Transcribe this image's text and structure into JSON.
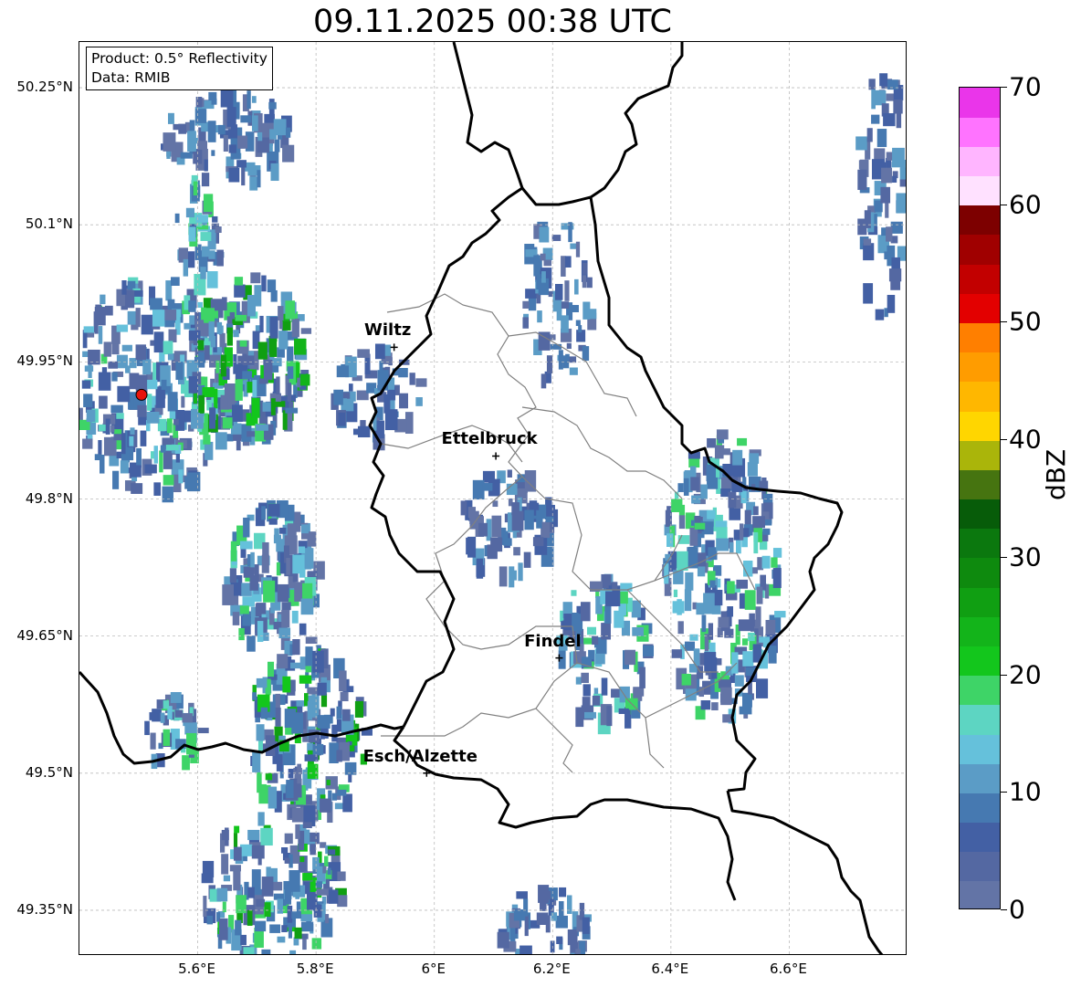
{
  "title": "09.11.2025 00:38 UTC",
  "info": {
    "product": "Product: 0.5° Reflectivity",
    "data": "Data: RMIB"
  },
  "map": {
    "extent_lon": [
      5.4,
      6.8
    ],
    "extent_lat": [
      49.3,
      50.3
    ],
    "lat_ticks": [
      {
        "value": 50.25,
        "label": "50.25°N"
      },
      {
        "value": 50.1,
        "label": "50.1°N"
      },
      {
        "value": 49.95,
        "label": "49.95°N"
      },
      {
        "value": 49.8,
        "label": "49.8°N"
      },
      {
        "value": 49.65,
        "label": "49.65°N"
      },
      {
        "value": 49.5,
        "label": "49.5°N"
      },
      {
        "value": 49.35,
        "label": "49.35°N"
      }
    ],
    "lon_ticks": [
      {
        "value": 5.6,
        "label": "5.6°E"
      },
      {
        "value": 5.8,
        "label": "5.8°E"
      },
      {
        "value": 6.0,
        "label": "6°E"
      },
      {
        "value": 6.2,
        "label": "6.2°E"
      },
      {
        "value": 6.4,
        "label": "6.4°E"
      },
      {
        "value": 6.6,
        "label": "6.6°E"
      }
    ],
    "radar_site": {
      "lon": 5.505,
      "lat": 49.914,
      "color": "#e8140c"
    },
    "cities": [
      {
        "name": "Wiltz",
        "lon": 5.932,
        "lat": 49.966
      },
      {
        "name": "Ettelbruck",
        "lon": 6.104,
        "lat": 49.847
      },
      {
        "name": "Findel",
        "lon": 6.211,
        "lat": 49.626
      },
      {
        "name": "Esch/Alzette",
        "lon": 5.987,
        "lat": 49.5
      }
    ],
    "echo_regions": [
      {
        "lon": 5.52,
        "lat": 49.93,
        "rlon": 0.14,
        "rlat": 0.12,
        "n": 260,
        "level": 2
      },
      {
        "lon": 5.68,
        "lat": 49.96,
        "rlon": 0.1,
        "rlat": 0.09,
        "n": 200,
        "level": 3
      },
      {
        "lon": 5.72,
        "lat": 49.72,
        "rlon": 0.08,
        "rlat": 0.08,
        "n": 140,
        "level": 2
      },
      {
        "lon": 5.78,
        "lat": 49.55,
        "rlon": 0.1,
        "rlat": 0.1,
        "n": 190,
        "level": 3
      },
      {
        "lon": 5.72,
        "lat": 49.38,
        "rlon": 0.12,
        "rlat": 0.08,
        "n": 160,
        "level": 3
      },
      {
        "lon": 6.48,
        "lat": 49.72,
        "rlon": 0.1,
        "rlat": 0.16,
        "n": 260,
        "level": 2
      },
      {
        "lon": 6.28,
        "lat": 49.64,
        "rlon": 0.08,
        "rlat": 0.08,
        "n": 90,
        "level": 2
      },
      {
        "lon": 6.12,
        "lat": 49.78,
        "rlon": 0.08,
        "rlat": 0.06,
        "n": 70,
        "level": 1
      },
      {
        "lon": 6.2,
        "lat": 50.02,
        "rlon": 0.06,
        "rlat": 0.1,
        "n": 70,
        "level": 1
      },
      {
        "lon": 5.65,
        "lat": 50.2,
        "rlon": 0.12,
        "rlat": 0.05,
        "n": 90,
        "level": 1
      },
      {
        "lon": 6.75,
        "lat": 50.15,
        "rlon": 0.04,
        "rlat": 0.15,
        "n": 70,
        "level": 1
      },
      {
        "lon": 6.18,
        "lat": 49.33,
        "rlon": 0.08,
        "rlat": 0.05,
        "n": 60,
        "level": 1
      },
      {
        "lon": 5.9,
        "lat": 49.92,
        "rlon": 0.08,
        "rlat": 0.05,
        "n": 60,
        "level": 1
      },
      {
        "lon": 5.6,
        "lat": 50.1,
        "rlon": 0.04,
        "rlat": 0.06,
        "n": 40,
        "level": 2
      },
      {
        "lon": 5.55,
        "lat": 49.55,
        "rlon": 0.05,
        "rlat": 0.04,
        "n": 40,
        "level": 2
      }
    ],
    "border_color": "#000000",
    "admin_color": "#808080",
    "grid_color": "#bbbbbb"
  },
  "colorbar": {
    "label": "dBZ",
    "min": 0,
    "max": 70,
    "ticks": [
      "0",
      "10",
      "20",
      "30",
      "40",
      "50",
      "60",
      "70"
    ],
    "colors": [
      "#6374a6",
      "#5468a2",
      "#4360a4",
      "#4679b1",
      "#5b9cc6",
      "#65c1db",
      "#5dd5c2",
      "#3ed467",
      "#13c61c",
      "#13b41a",
      "#109f12",
      "#0e8a0e",
      "#0b780e",
      "#075c09",
      "#467410",
      "#aab50a",
      "#ffd600",
      "#ffb700",
      "#ff9c00",
      "#ff7f00",
      "#e30000",
      "#c20000",
      "#a00000",
      "#7d0000",
      "#ffe1ff",
      "#ffb5ff",
      "#ff73ff",
      "#ea35ea"
    ]
  }
}
